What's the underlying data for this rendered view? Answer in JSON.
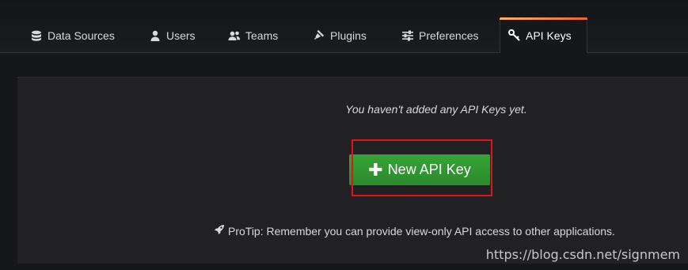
{
  "tabs": [
    {
      "label": "Data Sources",
      "icon": "database-icon"
    },
    {
      "label": "Users",
      "icon": "user-icon"
    },
    {
      "label": "Teams",
      "icon": "users-icon"
    },
    {
      "label": "Plugins",
      "icon": "plug-icon"
    },
    {
      "label": "Preferences",
      "icon": "sliders-icon"
    },
    {
      "label": "API Keys",
      "icon": "key-icon",
      "active": true
    }
  ],
  "panel": {
    "empty_message": "You haven't added any API Keys yet.",
    "new_button_label": "New API Key",
    "protip": "ProTip: Remember you can provide view-only API access to other applications."
  },
  "watermark": "https://blog.csdn.net/signmem",
  "colors": {
    "background": "#161719",
    "panel": "#212124",
    "button_green": "#2f962f",
    "active_tab_accent": "#f0652b",
    "highlight_box": "#e0151b"
  }
}
